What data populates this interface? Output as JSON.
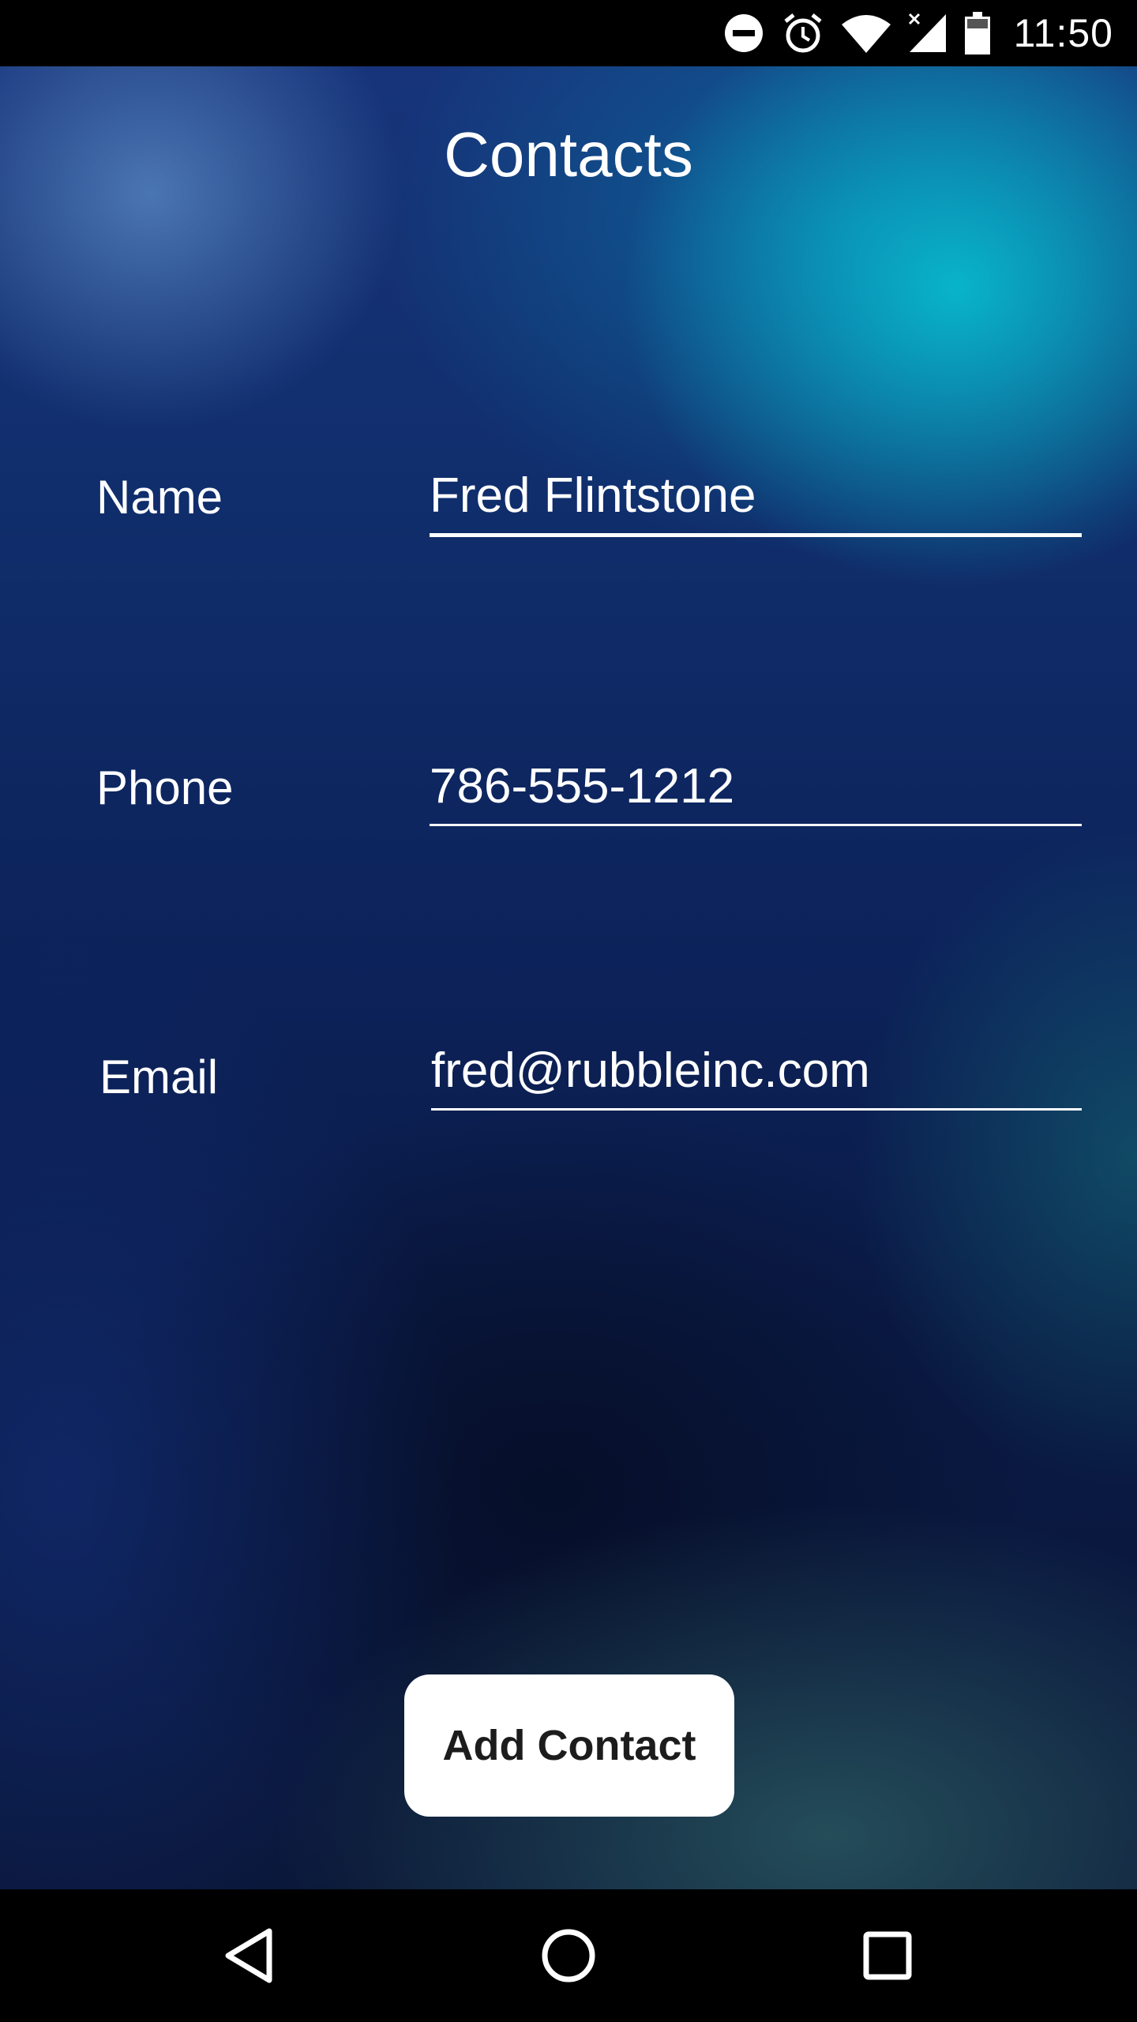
{
  "status_bar": {
    "time": "11:50",
    "icons": [
      "do-not-disturb-icon",
      "alarm-icon",
      "wifi-icon",
      "cellular-no-data-icon",
      "battery-icon"
    ]
  },
  "app": {
    "title": "Contacts",
    "fields": {
      "name": {
        "label": "Name",
        "value": "Fred Flintstone"
      },
      "phone": {
        "label": "Phone",
        "value": "786-555-1212"
      },
      "email": {
        "label": "Email",
        "value": "fred@rubbleinc.com"
      }
    },
    "add_button_label": "Add Contact"
  },
  "nav_bar": {
    "icons": [
      "back-icon",
      "home-icon",
      "recents-icon"
    ]
  }
}
